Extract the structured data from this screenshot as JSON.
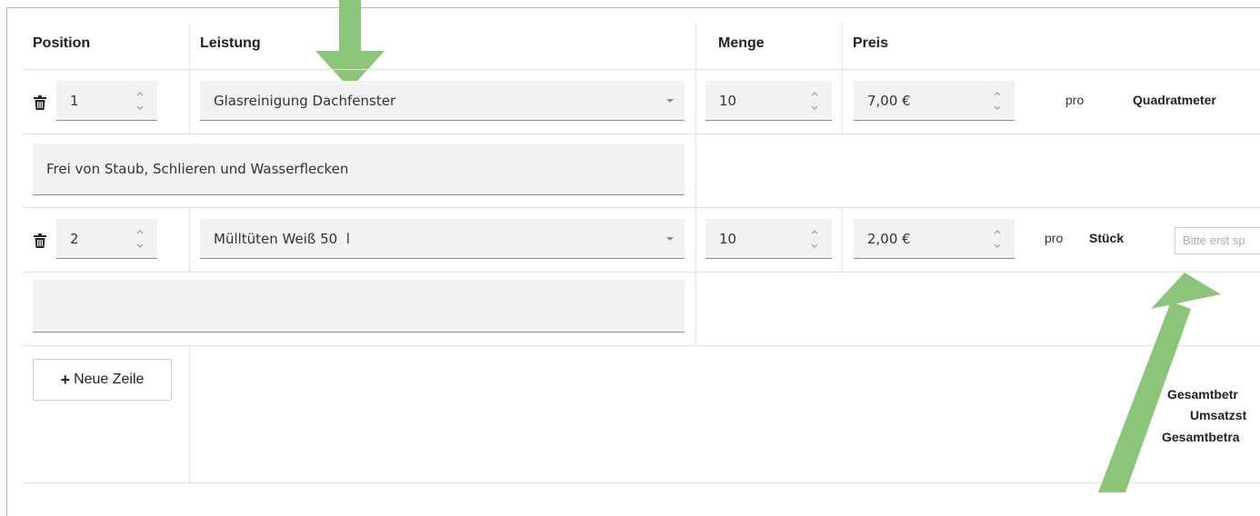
{
  "table": {
    "headers": [
      "Position",
      "Leistung",
      "Menge",
      "Preis"
    ]
  },
  "rows": [
    {
      "position": "1",
      "service": "Glasreinigung Dachfenster",
      "quantity": "10",
      "price": "7,00 €",
      "per_label": "pro",
      "unit": "Quadratmeter",
      "description": "Frei von Staub, Schlieren und Wasserflecken"
    },
    {
      "position": "2",
      "service": "Mülltüten Weiß 50  l",
      "quantity": "10",
      "price": "2,00 €",
      "per_label": "pro",
      "unit": "Stück",
      "unit_input_placeholder": "Bitte erst sp",
      "description": ""
    }
  ],
  "actions": {
    "new_row_label": "Neue Zeile",
    "new_row_icon": "plus-icon"
  },
  "totals": {
    "gross_label": "Gesamtbetr",
    "vat_label": "Umsatzst",
    "net_label": "Gesamtbetra"
  },
  "colors": {
    "accent_green": "#8cc47a",
    "panel_border": "#9ccc8e"
  }
}
